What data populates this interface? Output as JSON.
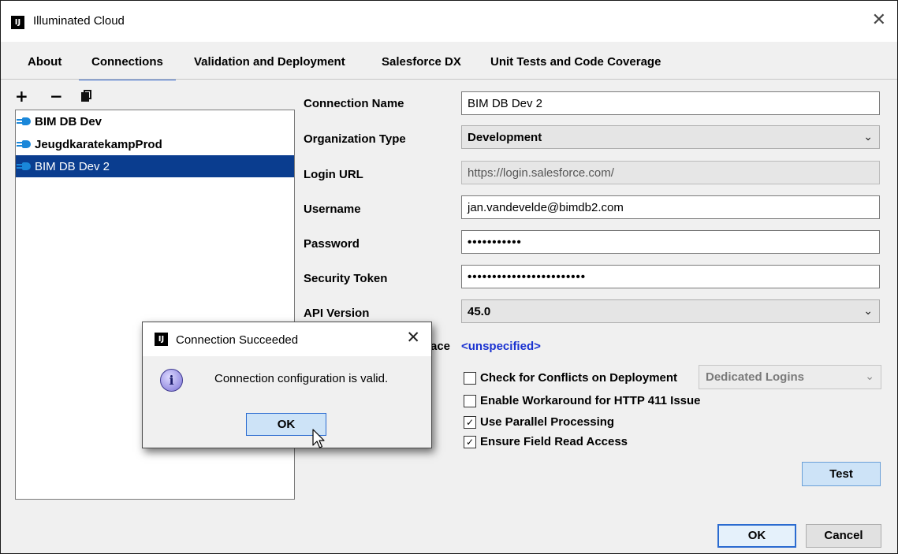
{
  "window": {
    "title": "Illuminated Cloud",
    "logo_text": "IJ",
    "close_glyph": "✕"
  },
  "tabs": [
    {
      "label": "About"
    },
    {
      "label": "Connections",
      "active": true
    },
    {
      "label": "Validation and Deployment"
    },
    {
      "label": "Salesforce DX"
    },
    {
      "label": "Unit Tests and Code Coverage"
    }
  ],
  "toolbar": {
    "add": "+",
    "remove": "−",
    "copy_icon": "copy-icon"
  },
  "connections": [
    {
      "label": "BIM DB Dev",
      "icon": "plug-icon"
    },
    {
      "label": "JeugdkaratekampProd",
      "icon": "plug-icon"
    },
    {
      "label": "BIM DB Dev 2",
      "icon": "plug-icon",
      "selected": true
    }
  ],
  "form": {
    "connection_name": {
      "label": "Connection Name",
      "value": "BIM DB Dev 2"
    },
    "organization_type": {
      "label": "Organization Type",
      "value": "Development"
    },
    "login_url": {
      "label": "Login URL",
      "value": "https://login.salesforce.com/"
    },
    "username": {
      "label": "Username",
      "value": "jan.vandevelde@bimdb2.com"
    },
    "password": {
      "label": "Password",
      "value": "•••••••••••"
    },
    "security_token": {
      "label": "Security Token",
      "value": "••••••••••••••••••••••••"
    },
    "api_version": {
      "label": "API Version",
      "value": "45.0"
    },
    "namespace": {
      "label_partial": "ace",
      "value": "<unspecified>"
    }
  },
  "options": {
    "check_conflicts": {
      "label": "Check for Conflicts on Deployment",
      "checked": false,
      "dropdown_value": "Dedicated Logins"
    },
    "workaround_411": {
      "label": "Enable Workaround for HTTP 411 Issue",
      "checked": false
    },
    "parallel": {
      "label": "Use Parallel Processing",
      "checked": true
    },
    "field_read": {
      "label": "Ensure Field Read Access",
      "checked": true
    }
  },
  "buttons": {
    "test": "Test",
    "ok": "OK",
    "cancel": "Cancel"
  },
  "dialog": {
    "title": "Connection Succeeded",
    "logo_text": "IJ",
    "close_glyph": "✕",
    "icon": "info-icon",
    "icon_glyph": "i",
    "message": "Connection configuration is valid.",
    "ok": "OK"
  },
  "check_glyph": "✓",
  "chevron": "⌄"
}
